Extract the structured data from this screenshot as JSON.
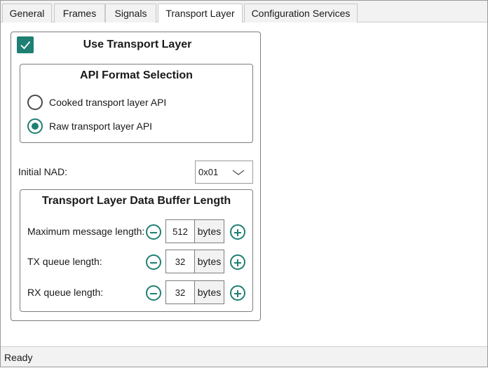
{
  "tabs": [
    {
      "label": "General"
    },
    {
      "label": "Frames"
    },
    {
      "label": "Signals"
    },
    {
      "label": "Transport Layer",
      "active": true
    },
    {
      "label": "Configuration Services"
    }
  ],
  "transport": {
    "use_label": "Use Transport Layer",
    "use_checked": true,
    "api": {
      "title": "API Format Selection",
      "options": [
        {
          "label": "Cooked transport layer API",
          "selected": false
        },
        {
          "label": "Raw transport layer API",
          "selected": true
        }
      ]
    },
    "nad": {
      "label": "Initial NAD:",
      "value": "0x01"
    },
    "buffer": {
      "title": "Transport Layer Data Buffer Length",
      "rows": [
        {
          "label": "Maximum message length:",
          "value": "512",
          "unit": "bytes"
        },
        {
          "label": "TX queue length:",
          "value": "32",
          "unit": "bytes"
        },
        {
          "label": "RX queue length:",
          "value": "32",
          "unit": "bytes"
        }
      ]
    }
  },
  "status": {
    "text": "Ready"
  },
  "colors": {
    "accent": "#1f7f73",
    "border": "#7d7d7d"
  },
  "icons": {
    "check": "checkmark-icon",
    "dropdown": "chevron-down-icon",
    "minus": "minus-circle-icon",
    "plus": "plus-circle-icon"
  }
}
